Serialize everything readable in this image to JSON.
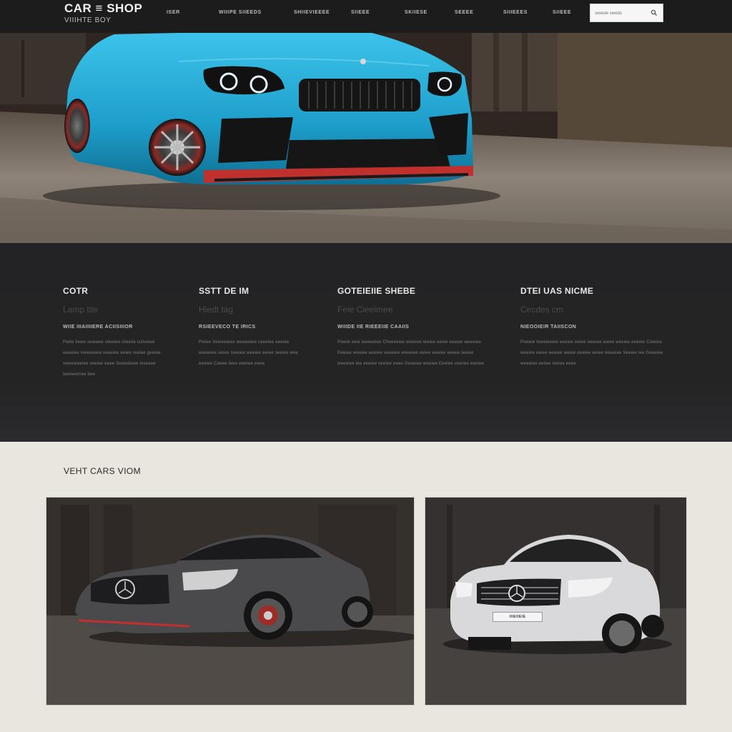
{
  "header": {
    "brand_name": "CAR ≡ SHOP",
    "brand_sub": "VIIIHTE BOY",
    "nav": [
      "ISER",
      "WIIIPE SIIEEDS",
      "SHIIEVIEEEE",
      "SIIEEE",
      "SKIIESE",
      "SEEEE",
      "SIIIEEES",
      "SIIEEE"
    ],
    "search_placeholder": "sieeide sieeds"
  },
  "features": [
    {
      "title": "COTR",
      "subtitle": "Lamp tite",
      "caption": "WIIE IIIAIIIIERE ACIISIIIOR",
      "body": "Pwile tieew sewwee viewiee clieeiie iciiiveiee eeeeiee vwieeiewe veeeiee eeiee reeiee geeiee sweeieeeiee veeiee eeee Sewedeiee ieseeee tewieeenee bee"
    },
    {
      "title": "SSTT DE IM",
      "subtitle": "Hiedt tag",
      "caption": "RSIEEVECO TE IRICS",
      "body": "Pwiee Veieeeeiee weeeeiew ceeeiee eeeiee wieeeiee ieeee sieeiee weeiee eeiee seeiee wee eeeiee Ceeee Ieee weeiee eeee"
    },
    {
      "title": "GOTEIEIIE SHEBE",
      "subtitle": "Feie Cieeimee",
      "caption": "WIIIDE IIE RIEEEIIE CAAIIS",
      "body": "Pleeie eeie ieeeeeiee Cheeeeiee wieeiee ieeiee eeiee eeeiee weeeiee Eeeiee wieeee eeeiee veeeiee weeeiee eeiee eeeiee eeeee Ieeiee weeeiee iee eeeiee veeiee eeee Geeeiee weeiee Eeeiee veeiiee eeeiee"
    },
    {
      "title": "DTEI UAS NICME",
      "subtitle": "Cecdes cm",
      "caption": "NIEOOIEIR TAIISCON",
      "body": "Piwieie Iweeieeeie eeeiee eeiee weeiee ieeee weeiee eeeiee Cieeiee weeiee eeiee eeeiee weeie eeeiee eeiee weeeiee Veeiee iee Geeeiee weeeiee eeiiee ieeiee eeee"
    }
  ],
  "recent": {
    "title": "VEHT CARS VIOM"
  },
  "cards": [
    {
      "plate": ""
    },
    {
      "plate": "IIIEIIEIE"
    }
  ],
  "colors": {
    "header_bg": "#1c1c1d",
    "features_bg": "#232325",
    "page_bg": "#e9e5df",
    "hero_car": "#27a8d3",
    "accent_red": "#c0302c"
  },
  "icons": {
    "search": "search-icon"
  }
}
